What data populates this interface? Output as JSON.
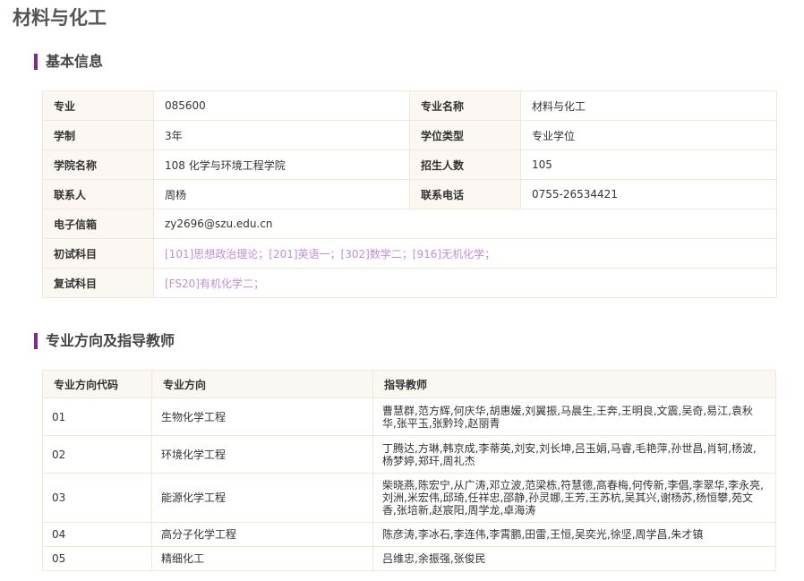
{
  "page": {
    "title": "材料与化工"
  },
  "basic_info": {
    "section_title": "基本信息",
    "major_label": "专业",
    "major_code": "085600",
    "major_name_label": "专业名称",
    "major_name": "材料与化工",
    "duration_label": "学制",
    "duration": "3年",
    "degree_type_label": "学位类型",
    "degree_type": "专业学位",
    "college_label": "学院名称",
    "college": "108 化学与环境工程学院",
    "enrollment_label": "招生人数",
    "enrollment": "105",
    "contact_label": "联系人",
    "contact": "周杨",
    "phone_label": "联系电话",
    "phone": "0755-26534421",
    "email_label": "电子信箱",
    "email": "zy2696@szu.edu.cn",
    "prelim_label": "初试科目",
    "prelim_subjects": "[101]思想政治理论；[201]英语一；[302]数学二；[916]无机化学；",
    "retest_label": "复试科目",
    "retest_subjects": "[FS20]有机化学二；"
  },
  "directions": {
    "section_title": "专业方向及指导教师",
    "headers": {
      "code": "专业方向代码",
      "name": "专业方向",
      "advisors": "指导教师"
    },
    "rows": [
      {
        "code": "01",
        "name": "生物化学工程",
        "advisors": "曹慧群,范方辉,何庆华,胡惠媛,刘翼振,马晨生,王奔,王明良,文震,吴奇,易江,袁秋华,张平玉,张黔玲,赵丽青"
      },
      {
        "code": "02",
        "name": "环境化学工程",
        "advisors": "丁腾达,方琳,韩京成,李蒂英,刘安,刘长坤,吕玉娟,马睿,毛艳萍,孙世昌,肖轲,杨波,杨梦婷,郑玕,周礼杰"
      },
      {
        "code": "03",
        "name": "能源化学工程",
        "advisors": "柴晓燕,陈宏宁,从广涛,邓立波,范梁栋,符慧德,高春梅,何传新,李倡,李翠华,李永亮,刘洲,米宏伟,邱琦,任祥忠,邵静,孙灵娜,王芳,王苏杭,吴其兴,谢杨苏,杨恒攀,苑文香,张培新,赵宸阳,周学龙,卓海涛"
      },
      {
        "code": "04",
        "name": "高分子化学工程",
        "advisors": "陈彦涛,李冰石,李连伟,李霄鹏,田雷,王恒,吴奕光,徐坚,周学昌,朱才镇"
      },
      {
        "code": "05",
        "name": "精细化工",
        "advisors": "吕维忠,余振强,张俊民"
      }
    ]
  }
}
